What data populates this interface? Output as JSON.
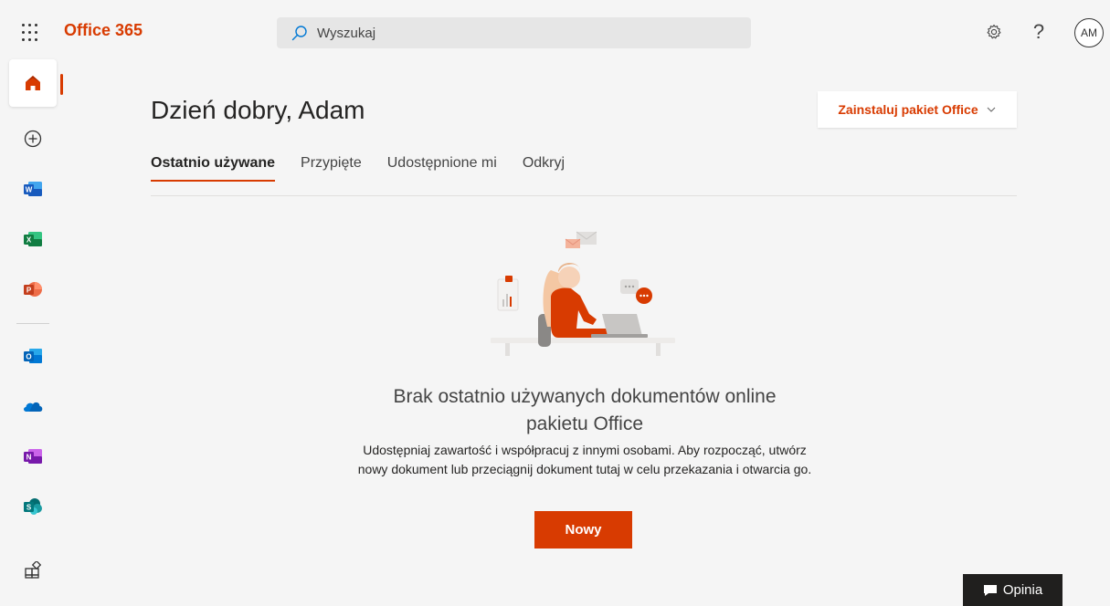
{
  "header": {
    "brand": "Office 365",
    "search_placeholder": "Wyszukaj",
    "help_label": "?",
    "avatar_initials": "AM"
  },
  "rail": {
    "items": [
      {
        "name": "home-icon",
        "label": "Strona główna"
      },
      {
        "name": "create-icon",
        "label": "Utwórz"
      },
      {
        "name": "word-icon",
        "label": "Word",
        "letter": "W",
        "color": "#2b579a"
      },
      {
        "name": "excel-icon",
        "label": "Excel",
        "letter": "X",
        "color": "#217346"
      },
      {
        "name": "powerpoint-icon",
        "label": "PowerPoint",
        "letter": "P",
        "color": "#c43e1c"
      },
      {
        "name": "outlook-icon",
        "label": "Outlook",
        "letter": "O",
        "color": "#0078d4"
      },
      {
        "name": "onedrive-icon",
        "label": "OneDrive",
        "color": "#0364b8"
      },
      {
        "name": "onenote-icon",
        "label": "OneNote",
        "letter": "N",
        "color": "#7719aa"
      },
      {
        "name": "sharepoint-icon",
        "label": "SharePoint",
        "letter": "S",
        "color": "#03787c"
      },
      {
        "name": "all-apps-icon",
        "label": "Wszystkie aplikacje"
      }
    ]
  },
  "main": {
    "greeting": "Dzień dobry, Adam",
    "install_label": "Zainstaluj pakiet Office",
    "tabs": [
      {
        "label": "Ostatnio używane",
        "active": true
      },
      {
        "label": "Przypięte",
        "active": false
      },
      {
        "label": "Udostępnione mi",
        "active": false
      },
      {
        "label": "Odkryj",
        "active": false
      }
    ],
    "empty_title": "Brak ostatnio używanych dokumentów online pakietu Office",
    "empty_description": "Udostępniaj zawartość i współpracuj z innymi osobami. Aby rozpocząć, utwórz nowy dokument lub przeciągnij dokument tutaj w celu przekazania i otwarcia go.",
    "new_button": "Nowy"
  },
  "feedback_label": "Opinia",
  "colors": {
    "accent": "#d83b01",
    "background": "#f5f5f5",
    "feedback_bg": "#201f1e"
  }
}
